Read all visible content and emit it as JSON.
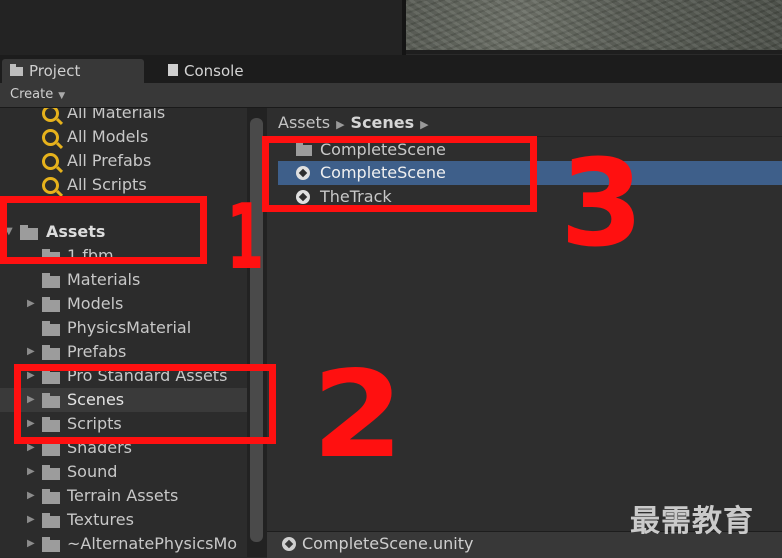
{
  "tabs": {
    "project": "Project",
    "console": "Console"
  },
  "toolbar": {
    "create_label": "Create"
  },
  "tree": {
    "searches": [
      "All Materials",
      "All Models",
      "All Prefabs",
      "All Scripts"
    ],
    "root": "Assets",
    "folders": [
      "1 fbm",
      "Materials",
      "Models",
      "PhysicsMaterial",
      "Prefabs",
      "Pro Standard Assets",
      "Scenes",
      "Scripts",
      "Shaders",
      "Sound",
      "Terrain Assets",
      "Textures",
      "~AlternatePhysicsMo"
    ]
  },
  "breadcrumb": {
    "root": "Assets",
    "current": "Scenes"
  },
  "files": [
    {
      "label": "CompleteScene",
      "kind": "folder-icon"
    },
    {
      "label": "CompleteScene",
      "kind": "unity-scene-icon"
    },
    {
      "label": "TheTrack",
      "kind": "unity-scene-icon"
    }
  ],
  "status": {
    "selected_file": "CompleteScene.unity"
  },
  "annotations": {
    "n1": "1",
    "n2": "2",
    "n3": "3",
    "color": "#ff1010"
  },
  "watermark": "最需教育"
}
